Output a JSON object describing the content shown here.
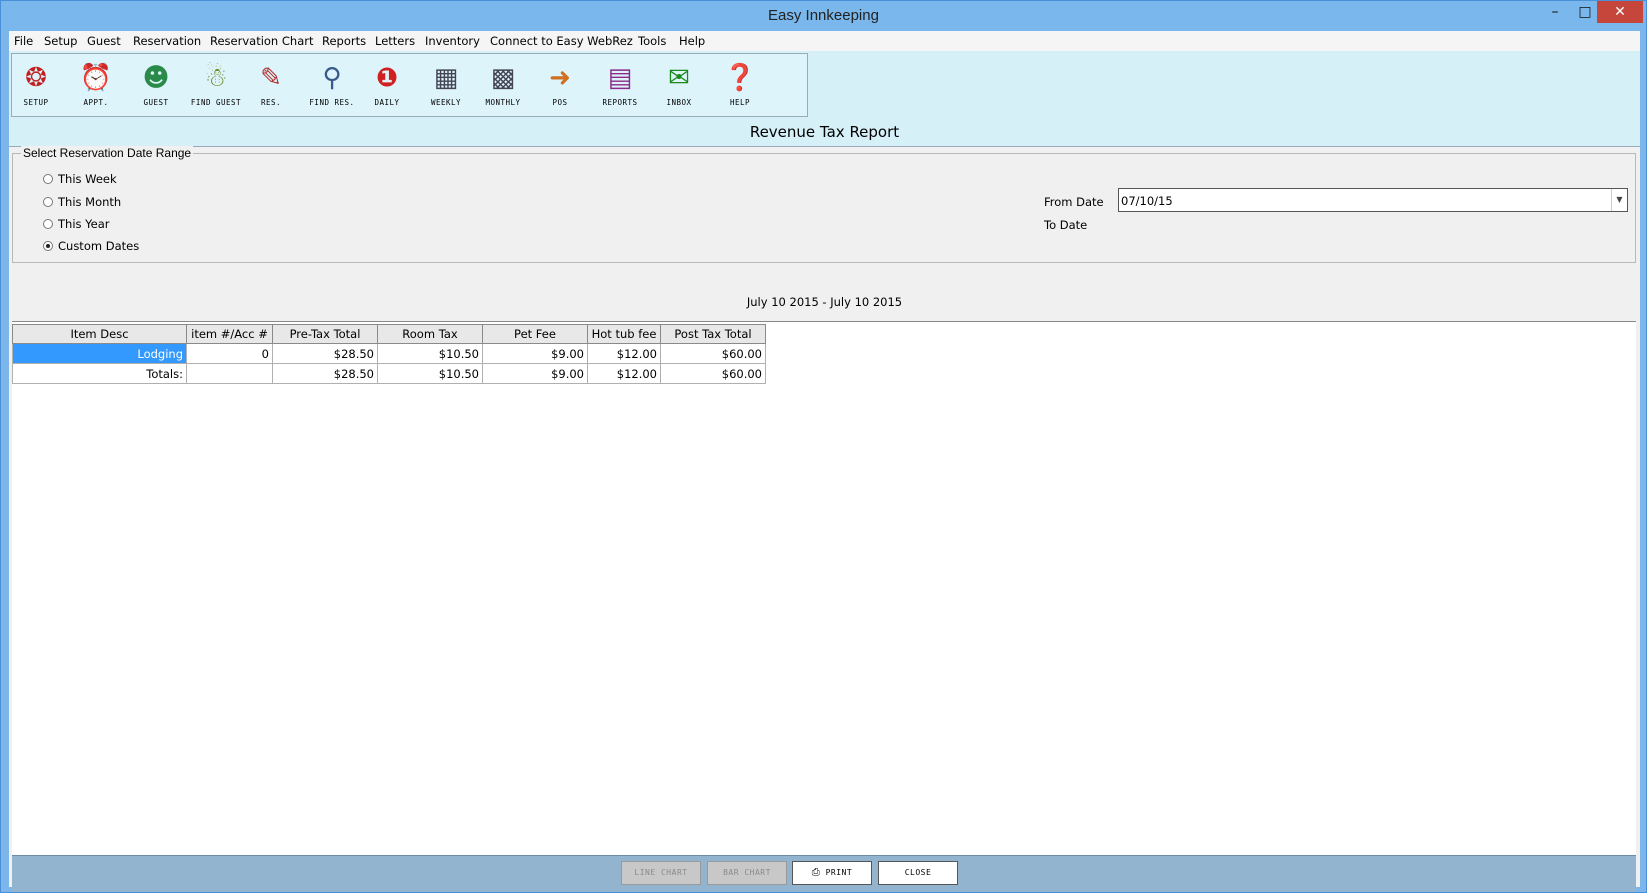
{
  "window": {
    "title": "Easy Innkeeping"
  },
  "menu": [
    "File",
    "Setup",
    "Guest",
    "Reservation",
    "Reservation Chart",
    "Reports",
    "Letters",
    "Inventory",
    "Connect to Easy WebRez",
    "Tools",
    "Help"
  ],
  "toolbar": [
    {
      "label": "SETUP",
      "icon": "setup-icon"
    },
    {
      "label": "APPT.",
      "icon": "alarm-clock-icon"
    },
    {
      "label": "GUEST",
      "icon": "guest-icon"
    },
    {
      "label": "FIND GUEST",
      "icon": "find-guest-icon"
    },
    {
      "label": "RES.",
      "icon": "reservation-icon"
    },
    {
      "label": "FIND RES.",
      "icon": "find-reservation-icon"
    },
    {
      "label": "DAILY",
      "icon": "daily-calendar-icon"
    },
    {
      "label": "WEEKLY",
      "icon": "weekly-calendar-icon"
    },
    {
      "label": "MONTHLY",
      "icon": "monthly-calendar-icon"
    },
    {
      "label": "POS",
      "icon": "pos-door-icon"
    },
    {
      "label": "REPORTS",
      "icon": "reports-chart-icon"
    },
    {
      "label": "INBOX",
      "icon": "email-inbox-icon"
    },
    {
      "label": "HELP",
      "icon": "help-icon"
    }
  ],
  "report": {
    "title": "Revenue Tax Report",
    "group_label": "Select Reservation Date Range",
    "radios": [
      {
        "label": "This Week",
        "checked": false
      },
      {
        "label": "This Month",
        "checked": false
      },
      {
        "label": "This Year",
        "checked": false
      },
      {
        "label": "Custom Dates",
        "checked": true
      }
    ],
    "from_date_label": "From Date",
    "from_date_value": "07/10/15",
    "to_date_label": "To Date",
    "range_text": "July 10 2015 - July 10 2015"
  },
  "table": {
    "columns": [
      "Item Desc",
      "item #/Acc #",
      "Pre-Tax Total",
      "Room Tax",
      "Pet Fee",
      "Hot tub fee",
      "Post Tax Total"
    ],
    "rows": [
      [
        "Lodging",
        "0",
        "$28.50",
        "$10.50",
        "$9.00",
        "$12.00",
        "$60.00"
      ],
      [
        "Totals:",
        "",
        "$28.50",
        "$10.50",
        "$9.00",
        "$12.00",
        "$60.00"
      ]
    ]
  },
  "buttons": {
    "line_chart": "LINE CHART",
    "bar_chart": "BAR CHART",
    "print": "PRINT",
    "close": "CLOSE"
  }
}
